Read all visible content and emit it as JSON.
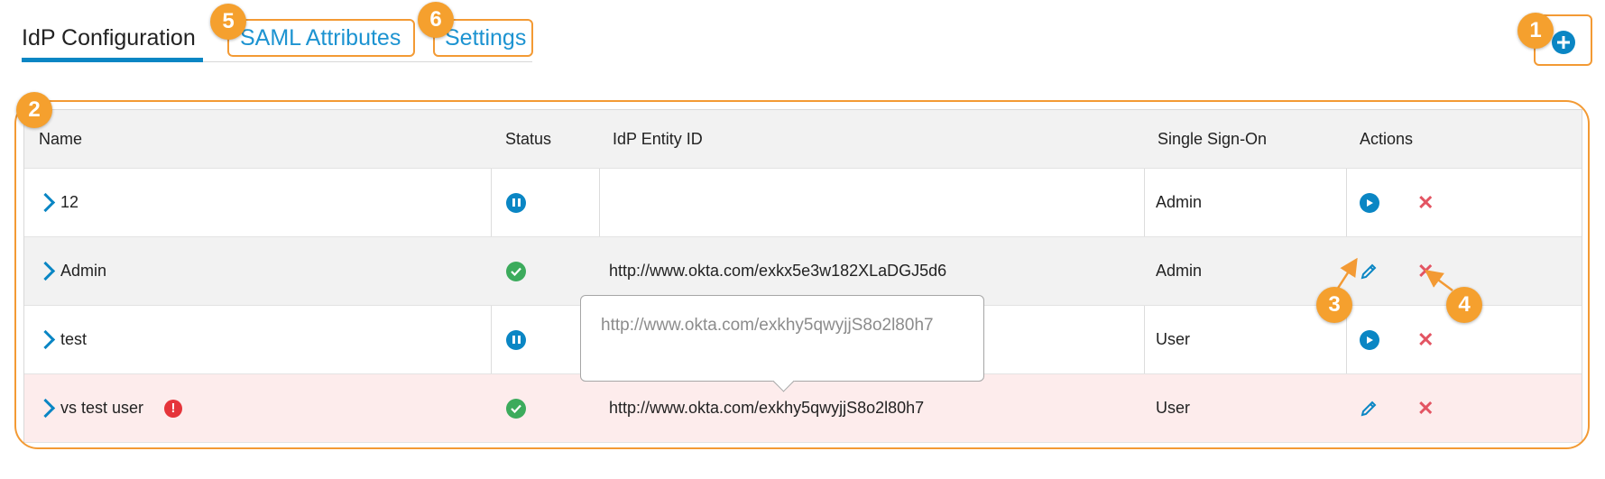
{
  "tabs": [
    {
      "label": "IdP Configuration",
      "active": true
    },
    {
      "label": "SAML Attributes",
      "active": false
    },
    {
      "label": "Settings",
      "active": false
    }
  ],
  "add_button": {
    "icon": "plus-circle-icon"
  },
  "table": {
    "columns": [
      "Name",
      "Status",
      "IdP Entity ID",
      "Single Sign-On",
      "Actions"
    ],
    "rows": [
      {
        "name": "12",
        "status": "paused",
        "entity_id": "",
        "sso": "Admin",
        "actions": [
          "enable",
          "delete"
        ]
      },
      {
        "name": "Admin",
        "status": "active",
        "entity_id": "http://www.okta.com/exkx5e3w182XLaDGJ5d6",
        "sso": "Admin",
        "actions": [
          "edit",
          "delete"
        ]
      },
      {
        "name": "test",
        "status": "paused",
        "entity_id": "",
        "sso": "User",
        "actions": [
          "enable",
          "delete"
        ]
      },
      {
        "name": "vs test user",
        "status": "active",
        "error": true,
        "entity_id": "http://www.okta.com/exkhy5qwyjjS8o2l80h7",
        "sso": "User",
        "actions": [
          "edit",
          "delete"
        ]
      }
    ]
  },
  "tooltip": {
    "text": "http://www.okta.com/exkhy5qwyjjS8o2l80h7"
  },
  "callouts": [
    "1",
    "2",
    "3",
    "4",
    "5",
    "6"
  ],
  "colors": {
    "accent": "#0a86c4",
    "callout": "#f5a02e",
    "delete": "#e35462",
    "success": "#3cab5c",
    "error_row": "#fdecec"
  }
}
